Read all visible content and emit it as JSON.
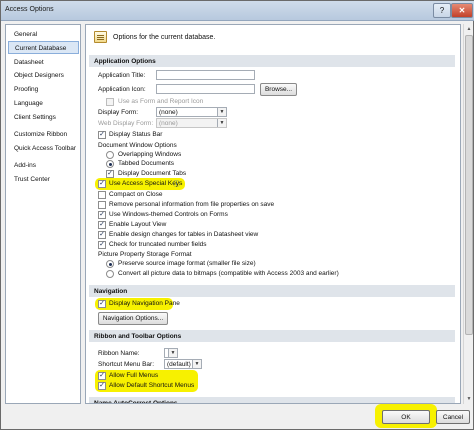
{
  "window": {
    "title": "Access Options",
    "help_glyph": "?",
    "close_glyph": "✕"
  },
  "sidebar": {
    "items": [
      {
        "label": "General"
      },
      {
        "label": "Current Database",
        "selected": true
      },
      {
        "label": "Datasheet"
      },
      {
        "label": "Object Designers"
      },
      {
        "label": "Proofing"
      },
      {
        "label": "Language"
      },
      {
        "label": "Client Settings"
      },
      {
        "label": "Customize Ribbon"
      },
      {
        "label": "Quick Access Toolbar"
      },
      {
        "label": "Add-ins"
      },
      {
        "label": "Trust Center"
      }
    ]
  },
  "header": {
    "text": "Options for the current database."
  },
  "application_options": {
    "section_label": "Application Options",
    "title_label": "Application Title:",
    "title_value": "",
    "icon_label": "Application Icon:",
    "icon_value": "",
    "browse_label": "Browse...",
    "use_as_form_icon": {
      "label": "Use as Form and Report Icon",
      "checked": false,
      "disabled": true
    },
    "display_form_label": "Display Form:",
    "display_form_value": "(none)",
    "web_display_form_label": "Web Display Form:",
    "web_display_form_value": "(none)",
    "display_status_bar": {
      "label": "Display Status Bar",
      "checked": true
    },
    "document_window_options_label": "Document Window Options",
    "overlapping_windows": {
      "label": "Overlapping Windows",
      "selected": false
    },
    "tabbed_documents": {
      "label": "Tabbed Documents",
      "selected": true
    },
    "display_document_tabs": {
      "label": "Display Document Tabs",
      "checked": true
    },
    "use_access_special_keys": {
      "label": "Use Access Special Keys",
      "checked": true,
      "info_glyph": "ⓘ"
    },
    "compact_on_close": {
      "label": "Compact on Close",
      "checked": false
    },
    "remove_personal_info": {
      "label": "Remove personal information from file properties on save",
      "checked": false
    },
    "windows_themed_controls": {
      "label": "Use Windows-themed Controls on Forms",
      "checked": true
    },
    "enable_layout_view": {
      "label": "Enable Layout View",
      "checked": true
    },
    "enable_design_changes": {
      "label": "Enable design changes for tables in Datasheet view",
      "checked": true
    },
    "check_truncated_fields": {
      "label": "Check for truncated number fields",
      "checked": true
    },
    "picture_storage_label": "Picture Property Storage Format",
    "preserve_source_image": {
      "label": "Preserve source image format (smaller file size)",
      "selected": true
    },
    "convert_bitmaps": {
      "label": "Convert all picture data to bitmaps (compatible with Access 2003 and earlier)",
      "selected": false
    }
  },
  "navigation": {
    "section_label": "Navigation",
    "display_navigation_pane": {
      "label": "Display Navigation Pane",
      "checked": true
    },
    "options_button_label": "Navigation Options..."
  },
  "ribbon_toolbar": {
    "section_label": "Ribbon and Toolbar Options",
    "ribbon_name_label": "Ribbon Name:",
    "ribbon_name_value": "",
    "shortcut_menu_bar_label": "Shortcut Menu Bar:",
    "shortcut_menu_bar_value": "(default)",
    "allow_full_menus": {
      "label": "Allow Full Menus",
      "checked": true
    },
    "allow_default_shortcut_menus": {
      "label": "Allow Default Shortcut Menus",
      "checked": true
    }
  },
  "name_autocorrect": {
    "section_label": "Name AutoCorrect Options"
  },
  "footer": {
    "ok_label": "OK",
    "cancel_label": "Cancel"
  },
  "colors": {
    "highlight": "#f7f100",
    "section_bg": "#dfe4ea",
    "selected_nav": "#dbe7f5",
    "check": "#1d2f55"
  },
  "scrollbar": {
    "up_glyph": "▲",
    "down_glyph": "▼"
  },
  "glyphs": {
    "check": "✓",
    "dropdown": "▼"
  }
}
